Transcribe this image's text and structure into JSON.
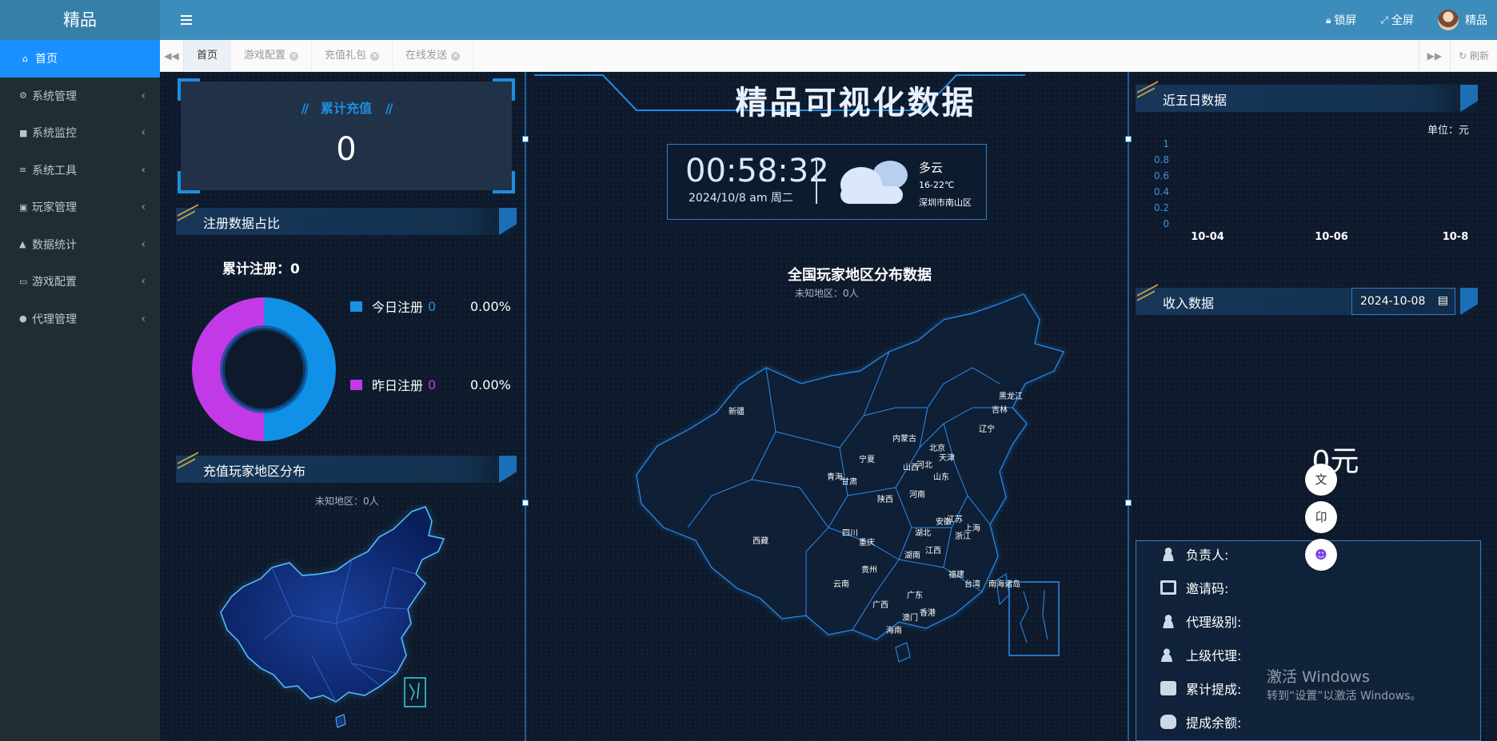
{
  "app": {
    "brand": "精品"
  },
  "topbar": {
    "lock_label": "锁屏",
    "fullscreen_label": "全屏",
    "user_name": "精品"
  },
  "sidebar": {
    "items": [
      {
        "label": "首页",
        "icon": "home-icon",
        "active": true
      },
      {
        "label": "系统管理",
        "icon": "gear-icon"
      },
      {
        "label": "系统监控",
        "icon": "video-camera-icon"
      },
      {
        "label": "系统工具",
        "icon": "bars-icon"
      },
      {
        "label": "玩家管理",
        "icon": "user-card-icon"
      },
      {
        "label": "数据统计",
        "icon": "area-chart-icon"
      },
      {
        "label": "游戏配置",
        "icon": "desktop-icon"
      },
      {
        "label": "代理管理",
        "icon": "users-icon"
      }
    ]
  },
  "tabs": [
    {
      "label": "首页",
      "active": true
    },
    {
      "label": "游戏配置"
    },
    {
      "label": "充值礼包"
    },
    {
      "label": "在线发送"
    }
  ],
  "tabbar": {
    "refresh_label": "刷新"
  },
  "dashboard": {
    "title": "精品可视化数据",
    "total_recharge": {
      "title": "累计充值",
      "value": "0"
    },
    "register": {
      "header": "注册数据占比",
      "total_label": "累计注册：",
      "total_value": "0",
      "today_label": "今日注册",
      "today_value": "0",
      "today_pct": "0.00%",
      "yesterday_label": "昨日注册",
      "yesterday_value": "0",
      "yesterday_pct": "0.00%"
    },
    "recharge_map": {
      "header": "充值玩家地区分布",
      "unknown": "未知地区：0人"
    },
    "clock": {
      "time": "00:58:32",
      "date": "2024/10/8   am   周二"
    },
    "weather": {
      "condition": "多云",
      "temp": "16-22℃",
      "location": "深圳市南山区"
    },
    "player_map": {
      "title": "全国玩家地区分布数据",
      "unknown": "未知地区：0人",
      "provinces": [
        "黑龙江",
        "吉林",
        "辽宁",
        "内蒙古",
        "北京",
        "天津",
        "河北",
        "山西",
        "山东",
        "新疆",
        "青海",
        "宁夏",
        "甘肃",
        "陕西",
        "河南",
        "西藏",
        "四川",
        "重庆",
        "湖北",
        "安徽",
        "江苏",
        "上海",
        "浙江",
        "湖南",
        "江西",
        "贵州",
        "云南",
        "福建",
        "台湾",
        "南海诸岛",
        "广西",
        "广东",
        "澳门",
        "香港",
        "海南"
      ]
    },
    "five_day": {
      "header": "近五日数据",
      "unit": "单位：元"
    },
    "income": {
      "header": "收入数据",
      "date": "2024-10-08",
      "value": "0元"
    },
    "agent": {
      "rows": [
        {
          "label": "负责人:",
          "icon": "person-icon"
        },
        {
          "label": "邀请码:",
          "icon": "copy-icon"
        },
        {
          "label": "代理级别:",
          "icon": "user-level-icon"
        },
        {
          "label": "上级代理:",
          "icon": "user-key-icon"
        },
        {
          "label": "累计提成:",
          "icon": "wallet-icon"
        },
        {
          "label": "提成余额:",
          "icon": "money-bag-icon"
        }
      ]
    },
    "watermark": {
      "line1": "激活 Windows",
      "line2": "转到“设置”以激活 Windows。"
    }
  },
  "chart_data": {
    "type": "line",
    "title": "近五日数据",
    "categories": [
      "10-04",
      "10-06",
      "10-8"
    ],
    "series": [
      {
        "values": [
          0,
          0,
          0
        ]
      }
    ],
    "yticks": [
      "1",
      "0.8",
      "0.6",
      "0.4",
      "0.2",
      "0"
    ],
    "ylim": [
      0,
      1
    ],
    "unit": "单位：元"
  },
  "colors": {
    "accent": "#1890ff",
    "today": "#1e90e6",
    "yesterday": "#c23ae8",
    "brand_bar": "#3c8dbc"
  }
}
